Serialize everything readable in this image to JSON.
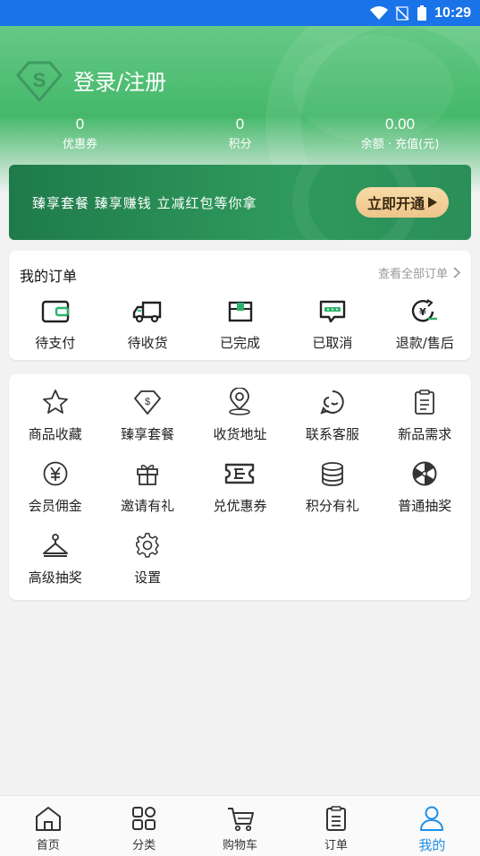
{
  "status_bar": {
    "time": "10:29"
  },
  "header": {
    "login_title": "登录/注册",
    "stats": [
      {
        "value": "0",
        "label": "优惠券"
      },
      {
        "value": "0",
        "label": "积分"
      },
      {
        "value": "0.00",
        "label": "余额 · 充值(元)"
      }
    ]
  },
  "banner": {
    "text": "臻享套餐 臻享赚钱 立减红包等你拿",
    "button_label": "立即开通"
  },
  "orders": {
    "title": "我的订单",
    "view_all": "查看全部订单",
    "items": [
      {
        "label": "待支付",
        "icon": "wallet-icon"
      },
      {
        "label": "待收货",
        "icon": "truck-icon"
      },
      {
        "label": "已完成",
        "icon": "box-icon"
      },
      {
        "label": "已取消",
        "icon": "message-icon"
      },
      {
        "label": "退款/售后",
        "icon": "refund-icon"
      }
    ]
  },
  "services": {
    "items": [
      {
        "label": "商品收藏",
        "icon": "star-icon"
      },
      {
        "label": "臻享套餐",
        "icon": "diamond-icon"
      },
      {
        "label": "收货地址",
        "icon": "location-icon"
      },
      {
        "label": "联系客服",
        "icon": "customer-service-icon"
      },
      {
        "label": "新品需求",
        "icon": "clipboard-icon"
      },
      {
        "label": "会员佣金",
        "icon": "yen-icon"
      },
      {
        "label": "邀请有礼",
        "icon": "gift-icon"
      },
      {
        "label": "兑优惠券",
        "icon": "ticket-icon"
      },
      {
        "label": "积分有礼",
        "icon": "coins-icon"
      },
      {
        "label": "普通抽奖",
        "icon": "wheel-icon"
      },
      {
        "label": "高级抽奖",
        "icon": "hanger-icon"
      },
      {
        "label": "设置",
        "icon": "settings-icon"
      }
    ]
  },
  "tabbar": {
    "items": [
      {
        "label": "首页",
        "icon": "home-icon",
        "active": false
      },
      {
        "label": "分类",
        "icon": "category-icon",
        "active": false
      },
      {
        "label": "购物车",
        "icon": "cart-icon",
        "active": false
      },
      {
        "label": "订单",
        "icon": "order-icon",
        "active": false
      },
      {
        "label": "我的",
        "icon": "user-icon",
        "active": true
      }
    ]
  },
  "colors": {
    "brand_green": "#44b86a",
    "active_tab": "#1e8fe6",
    "status_bar": "#1a73e8"
  }
}
